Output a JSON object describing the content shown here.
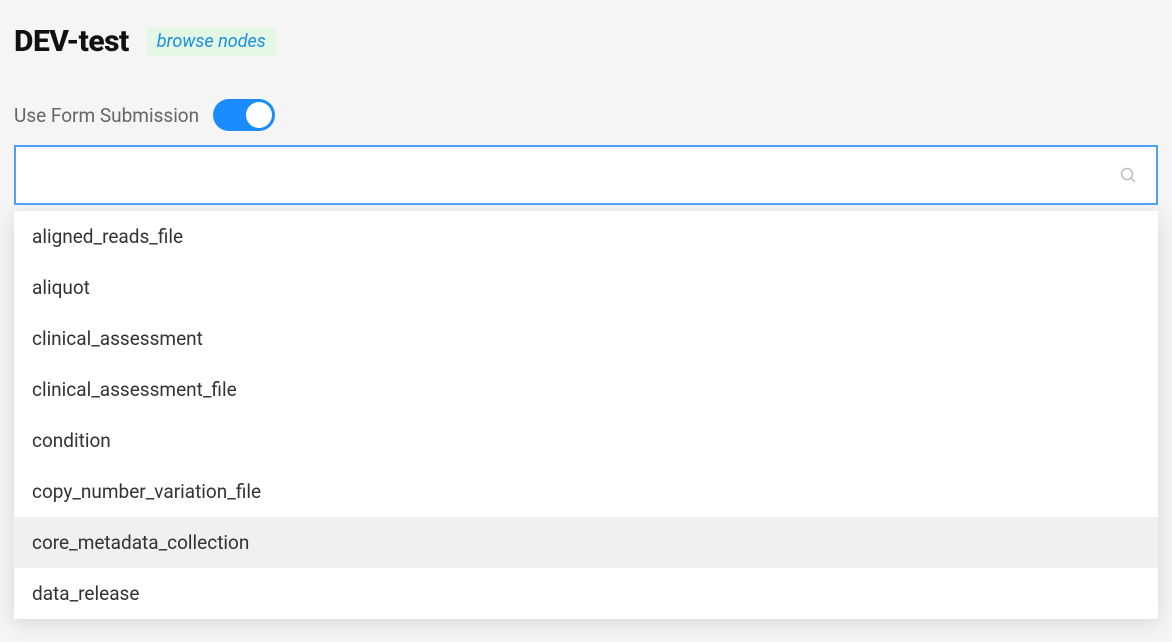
{
  "header": {
    "title": "DEV-test",
    "browse_link": "browse nodes"
  },
  "toggle": {
    "label": "Use Form Submission",
    "on": true
  },
  "search": {
    "value": "",
    "placeholder": ""
  },
  "dropdown": {
    "items": [
      "aligned_reads_file",
      "aliquot",
      "clinical_assessment",
      "clinical_assessment_file",
      "condition",
      "copy_number_variation_file",
      "core_metadata_collection",
      "data_release"
    ],
    "hovered_index": 6
  }
}
